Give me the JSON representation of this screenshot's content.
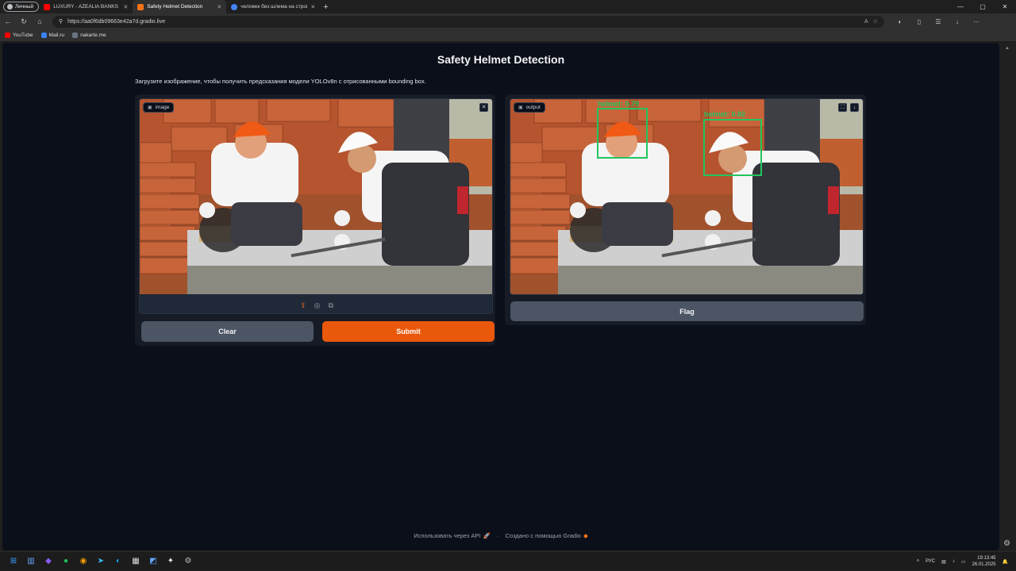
{
  "browser": {
    "profile_label": "Личный",
    "tabs": [
      {
        "title": "LUXURY - AZEALIA BANKS (**OFI",
        "fav_color": "#ff0000",
        "active": false
      },
      {
        "title": "Safety Helmet Detection",
        "fav_color": "#f97316",
        "active": true
      },
      {
        "title": "человек без шлема на стройке",
        "fav_color": "#4285f4",
        "active": false
      }
    ],
    "url": "https://aa0f6db09663e42a7d.gradio.live",
    "bookmarks": [
      {
        "label": "YouTube",
        "fav_color": "#ff0000"
      },
      {
        "label": "Mail.ru",
        "fav_color": "#3b82f6"
      },
      {
        "label": "nakarte.me",
        "fav_color": "#6b7280"
      }
    ]
  },
  "app": {
    "title": "Safety Helmet Detection",
    "description": "Загрузите изображение, чтобы получить предсказания модели YOLOv8n с отрисованными bounding box.",
    "input": {
      "label": "image"
    },
    "output": {
      "label": "output",
      "detections": [
        {
          "label": "helmet",
          "score": "0.79"
        },
        {
          "label": "helmet",
          "score": "0.82"
        }
      ]
    },
    "buttons": {
      "clear": "Clear",
      "submit": "Submit",
      "flag": "Flag"
    },
    "footer": {
      "api": "Использовать через API",
      "built": "Создано с помощью Gradio"
    }
  },
  "taskbar": {
    "lang": "РУС",
    "time": "19:13:45",
    "date": "26.01.2025"
  }
}
